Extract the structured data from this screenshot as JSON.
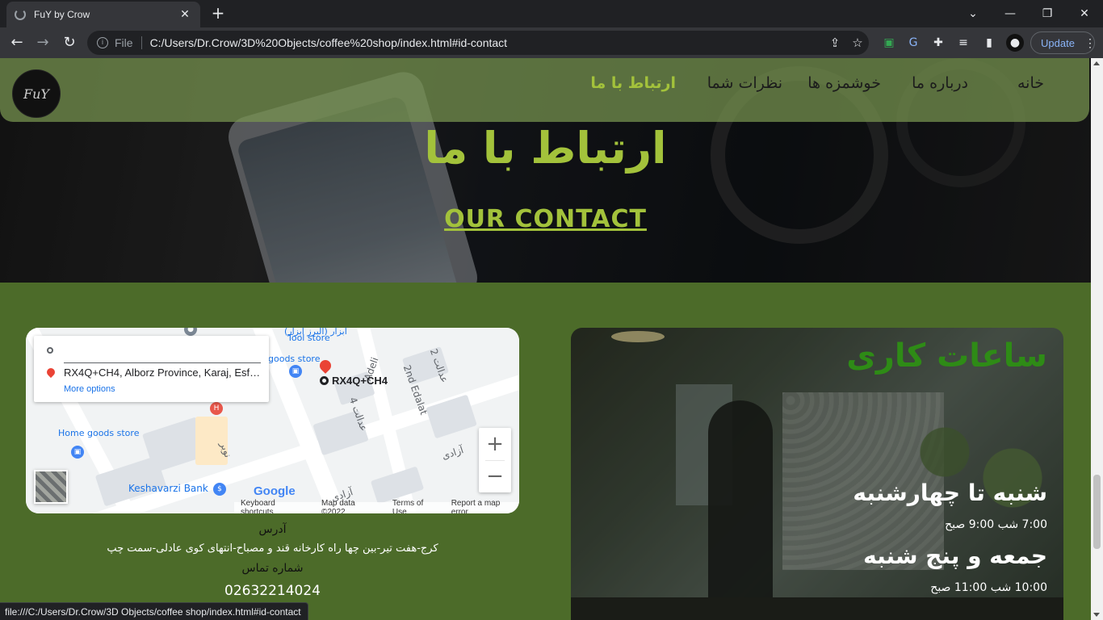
{
  "browser": {
    "tab_title": "FuY by Crow",
    "scheme_label": "File",
    "url": "C:/Users/Dr.Crow/3D%20Objects/coffee%20shop/index.html#id-contact",
    "update_label": "Update",
    "status_url": "file:///C:/Users/Dr.Crow/3D Objects/coffee shop/index.html#id-contact"
  },
  "nav": {
    "logo_text": "FuY",
    "items": [
      {
        "label": "خانه"
      },
      {
        "label": "درباره ما"
      },
      {
        "label": "خوشمزه ها"
      },
      {
        "label": "نظرات شما"
      },
      {
        "label": "ارتباط با ما"
      }
    ],
    "active_index": 4
  },
  "hero": {
    "title": "ارتباط با ما",
    "subtitle": "OUR CONTACT"
  },
  "map": {
    "address_line": "RX4Q+CH4, Alborz Province, Karaj, Esfa...",
    "more_options": "More options",
    "marker_label": "RX4Q+CH4",
    "labels": {
      "adeli": "Adeli",
      "second_edalat": "2nd Edalat",
      "edalat2_fa": "عدالت 2",
      "edalat4_fa": "عدالت 4",
      "azadi_fa": "آزادی",
      "azadi_fa2": "آزادی",
      "nowbar_fa": "نوبر",
      "tool_store_fa": "ابزار (البرز ابزار)",
      "tool_store": "Tool store",
      "goods_store": "goods store",
      "home_goods": "Home goods store",
      "bank": "Keshavarzi Bank"
    },
    "google_logo": "Google",
    "footer": {
      "shortcuts": "Keyboard shortcuts",
      "data": "Map data ©2022",
      "terms": "Terms of Use",
      "report": "Report a map error"
    },
    "colors": {
      "pin": "#ea4335",
      "link": "#1a73e8"
    }
  },
  "contact": {
    "address_label": "آدرس",
    "address": "کرج-هفت تیر-بین چها راه کارخانه قند و مصباح-انتهای کوی عادلی-سمت چپ",
    "phone_label": "شماره تماس",
    "phone": "02632214024"
  },
  "hours": {
    "title": "ساعات کاری",
    "entries": [
      {
        "days": "شنبه تا چهارشنبه",
        "time": "7:00 شب 9:00 صبح"
      },
      {
        "days": "جمعه و پنج شنبه",
        "time": "10:00 شب 11:00 صبح"
      }
    ]
  },
  "theme": {
    "accent": "#a3c23b",
    "page_bg": "#4c6b29",
    "hours_title": "#2e8b16"
  }
}
